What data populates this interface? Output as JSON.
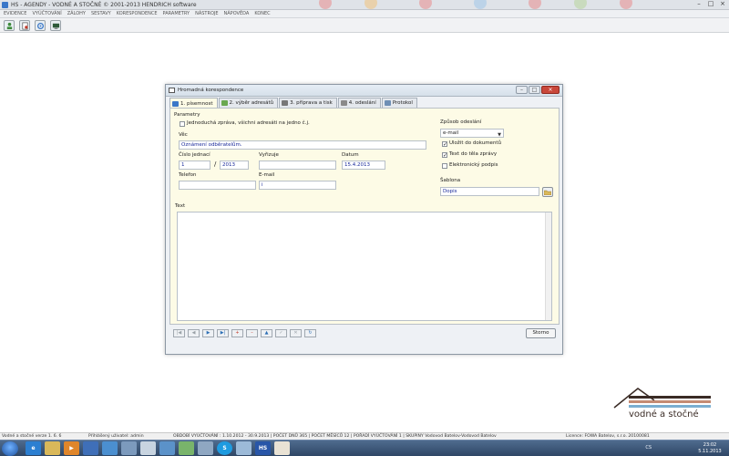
{
  "app": {
    "title": "HS - AGENDY - VODNÉ A STOČNÉ © 2001-2013 HENDRICH software"
  },
  "window_controls": {
    "minimize": "–",
    "maximize": "□",
    "close": "×"
  },
  "menu": [
    "EVIDENCE",
    "VYÚČTOVÁNÍ",
    "ZÁLOHY",
    "SESTAVY",
    "KORESPONDENCE",
    "PARAMETRY",
    "NÁSTROJE",
    "NÁPOVĚDA",
    "KONEC"
  ],
  "toolbar_icons": [
    "person-icon",
    "document-icon",
    "settings-icon",
    "monitor-icon"
  ],
  "dialog": {
    "title": "Hromadná korespondence",
    "buttons": {
      "minimize": "–",
      "maximize": "□",
      "close": "×"
    },
    "tabs": [
      {
        "label": "1. písemnost",
        "active": true,
        "color": "#3a77c8"
      },
      {
        "label": "2. výběr adresátů",
        "active": false,
        "color": "#6aa84f"
      },
      {
        "label": "3. příprava a tisk",
        "active": false,
        "color": "#777777"
      },
      {
        "label": "4. odeslání",
        "active": false,
        "color": "#8a8a8a"
      },
      {
        "label": "Protokol",
        "active": false,
        "color": "#6f8fb5"
      }
    ],
    "form": {
      "section_label": "Parametry",
      "single_message_label": "Jednoduchá zpráva, všichni adresáti na jedno č.j.",
      "single_message_checked": false,
      "subject_label": "Věc",
      "subject_value": "Oznámení odběratelům.",
      "reference_label": "Číslo jednací",
      "reference_number": "1",
      "reference_separator": "/",
      "reference_year": "2013",
      "handler_label": "Vyřizuje",
      "handler_value": "",
      "date_label": "Datum",
      "date_value": "15.4.2013",
      "phone_label": "Telefon",
      "phone_value": "",
      "email_label": "E-mail",
      "email_value": "i",
      "send_method_label": "Způsob odeslání",
      "send_method_value": "e-mail",
      "save_to_docs_label": "Uložit do dokumentů",
      "save_to_docs_checked": true,
      "text_in_body_label": "Text do těla zprávy",
      "text_in_body_checked": true,
      "e_signature_label": "Elektronický podpis",
      "e_signature_checked": false,
      "template_label": "Šablona",
      "template_value": "Dopis",
      "text_label": "Text",
      "text_value": ""
    },
    "nav_buttons": [
      {
        "name": "first-record",
        "glyph": "|◀",
        "tone": "grey"
      },
      {
        "name": "previous-record",
        "glyph": "◀",
        "tone": "grey"
      },
      {
        "name": "next-record",
        "glyph": "▶",
        "tone": "blue"
      },
      {
        "name": "last-record",
        "glyph": "▶|",
        "tone": "blue"
      },
      {
        "name": "add-record",
        "glyph": "+",
        "tone": "red"
      },
      {
        "name": "delete-record",
        "glyph": "–",
        "tone": "red"
      },
      {
        "name": "edit-record",
        "glyph": "▲",
        "tone": "blue"
      },
      {
        "name": "confirm-record",
        "glyph": "✓",
        "tone": "grey"
      },
      {
        "name": "cancel-record",
        "glyph": "✕",
        "tone": "grey"
      },
      {
        "name": "refresh-record",
        "glyph": "↻",
        "tone": "blue"
      }
    ],
    "storno_label": "Storno"
  },
  "logo": {
    "brand": "vodné a stočné",
    "colors": {
      "roof": "#3a2b25",
      "stripe1": "#3a2b25",
      "stripe2": "#c48b73",
      "stripe3": "#7aaed1"
    }
  },
  "statusbar": {
    "version": "Vodné a stočné verze 1. 6. 6",
    "user": "Přihlášený uživatel: admin",
    "period": "OBDOBÍ VYÚČTOVÁNÍ : 1.10.2012 - 30.9.2013 | POČET DNŮ 365 | POČET MĚSÍCŮ 12 | POŘADÍ VYÚČTOVÁNÍ 1 | SKUPINY Vodovod Batelov-Vodovod Batelov",
    "licence": "Licence: FOWA Batelov, s.r.o. 20100081"
  },
  "taskbar": {
    "apps": [
      {
        "name": "ie-app",
        "label": "e",
        "color": "#2c7fd1"
      },
      {
        "name": "explorer-app",
        "label": "",
        "color": "#d9b85a"
      },
      {
        "name": "media-app",
        "label": "▶",
        "color": "#e0862b"
      },
      {
        "name": "app-4",
        "label": "",
        "color": "#3f6fb8"
      },
      {
        "name": "app-5",
        "label": "",
        "color": "#4b8fd0"
      },
      {
        "name": "app-6",
        "label": "",
        "color": "#7c9abd"
      },
      {
        "name": "app-7",
        "label": "",
        "color": "#c8d4e0"
      },
      {
        "name": "app-8",
        "label": "",
        "color": "#5b92c9"
      },
      {
        "name": "app-9",
        "label": "",
        "color": "#79b46b"
      },
      {
        "name": "app-10",
        "label": "",
        "color": "#8fa7c2"
      },
      {
        "name": "skype-app",
        "label": "S",
        "color": "#1e9be0"
      },
      {
        "name": "app-12",
        "label": "",
        "color": "#9cbad8"
      },
      {
        "name": "hs-app",
        "label": "HS",
        "color": "#2856a8"
      },
      {
        "name": "vodne-app",
        "label": "",
        "color": "#e9e2d4"
      }
    ],
    "language": "CS",
    "time": "23:02",
    "date": "5.11.2013"
  }
}
